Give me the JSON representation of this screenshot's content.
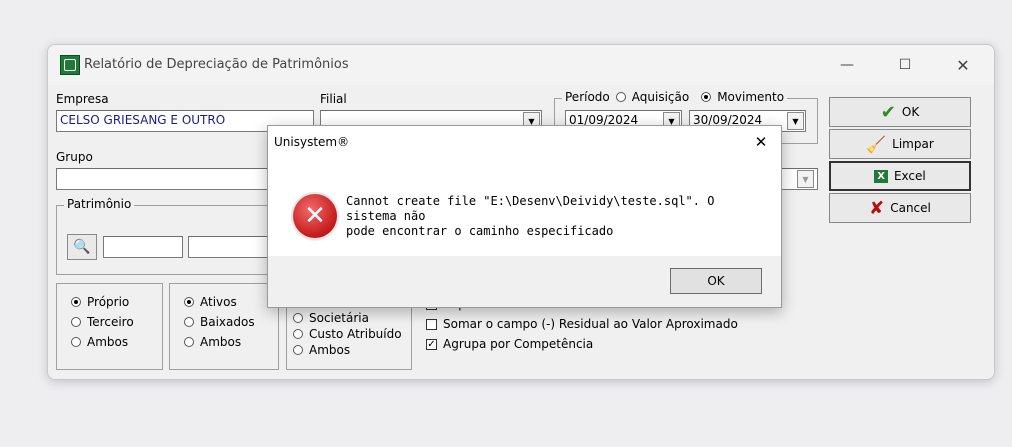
{
  "window": {
    "title": "Relatório de Depreciação de Patrimônios",
    "minimize_glyph": "—",
    "maximize_glyph": "☐",
    "close_glyph": "✕"
  },
  "form": {
    "empresa": {
      "label": "Empresa",
      "value": "CELSO GRIESANG E OUTRO"
    },
    "filial": {
      "label": "Filial",
      "value": ""
    },
    "periodo": {
      "legend": "Período",
      "options": [
        {
          "label": "Aquisição",
          "selected": false
        },
        {
          "label": "Movimento",
          "selected": true
        }
      ],
      "start": "01/09/2024",
      "end": "30/09/2024"
    },
    "grupo": {
      "label": "Grupo",
      "value": ""
    },
    "patrimonio": {
      "legend": "Patrimônio"
    },
    "proprio_group": [
      {
        "label": "Próprio",
        "selected": true
      },
      {
        "label": "Terceiro",
        "selected": false
      },
      {
        "label": "Ambos",
        "selected": false
      }
    ],
    "status_group": [
      {
        "label": "Ativos",
        "selected": true
      },
      {
        "label": "Baixados",
        "selected": false
      },
      {
        "label": "Ambos",
        "selected": false
      }
    ],
    "tipo_group": [
      {
        "label": "Societária",
        "selected": false
      },
      {
        "label": "Custo Atribuído",
        "selected": false
      },
      {
        "label": "Ambos",
        "selected": false
      }
    ],
    "checks": [
      {
        "label": "Imprimir Resumo",
        "checked": false
      },
      {
        "label": "Somar o campo (-) Residual ao Valor Aproximado",
        "checked": false
      },
      {
        "label": "Agrupa por Competência",
        "checked": true
      }
    ]
  },
  "buttons": {
    "ok": "OK",
    "limpar": "Limpar",
    "excel": "Excel",
    "cancel": "Cancel"
  },
  "dialog": {
    "title": "Unisystem®",
    "close_glyph": "✕",
    "message_line1": "Cannot create file \"E:\\Desenv\\Deividy\\teste.sql\". O sistema não",
    "message_line2": "pode encontrar o caminho especificado",
    "ok": "OK",
    "icon_glyph": "✕"
  },
  "colors": {
    "empresa_text": "#1a1a8c",
    "error_red": "#c41a1a",
    "ok_check": "#2e8b1e",
    "cancel_x": "#b01010"
  }
}
